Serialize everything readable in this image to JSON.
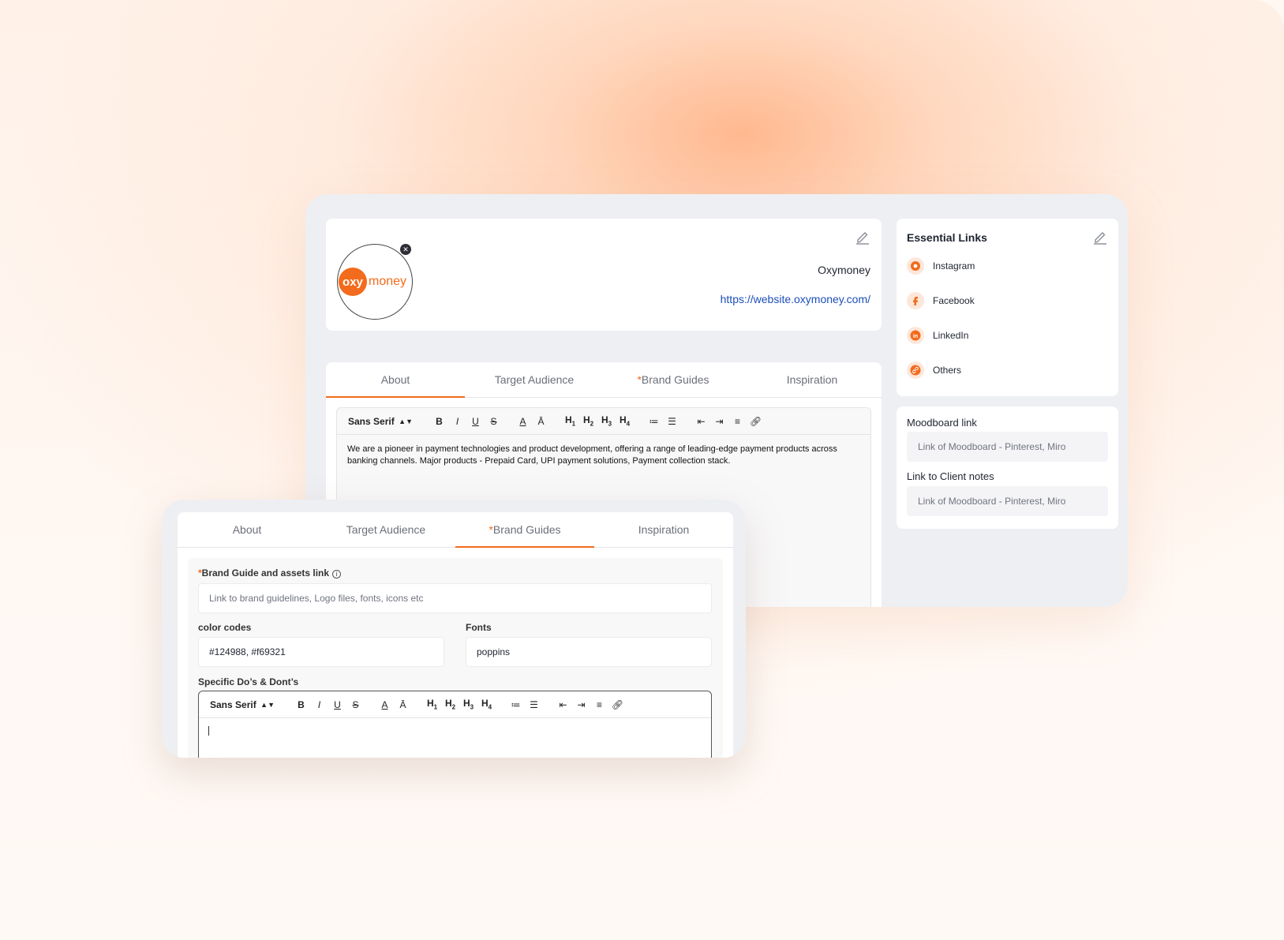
{
  "profile": {
    "logo_left": "oxy",
    "logo_right": "money",
    "brand_name": "Oxymoney",
    "website": "https://website.oxymoney.com/"
  },
  "tabs": [
    {
      "label": "About",
      "required": false
    },
    {
      "label": "Target Audience",
      "required": false
    },
    {
      "label": "Brand Guides",
      "required": true
    },
    {
      "label": "Inspiration",
      "required": false
    }
  ],
  "required_mark": "*",
  "editor": {
    "font": "Sans Serif",
    "about_text": "We are a pioneer in payment technologies and product development, offering a range of leading-edge payment products across banking channels. Major products - Prepaid Card, UPI payment solutions, Payment collection stack."
  },
  "essential_links": {
    "title": "Essential Links",
    "items": [
      {
        "label": "Instagram",
        "icon": "instagram-icon"
      },
      {
        "label": "Facebook",
        "icon": "facebook-icon"
      },
      {
        "label": "LinkedIn",
        "icon": "linkedin-icon"
      },
      {
        "label": "Others",
        "icon": "link-icon"
      }
    ]
  },
  "moodboard": {
    "label": "Moodboard link",
    "placeholder": "Link of Moodboard - Pinterest, Miro",
    "client_label": "Link to Client notes",
    "client_placeholder": "Link of Moodboard - Pinterest, Miro"
  },
  "brand_guides": {
    "assets_label": "Brand Guide and assets link",
    "assets_placeholder": "Link to brand guidelines, Logo files, fonts, icons etc",
    "color_label": "color codes",
    "color_value": "#124988, #f69321",
    "fonts_label": "Fonts",
    "fonts_value": "poppins",
    "dos_label": "Specific Do’s & Dont’s"
  },
  "colors": {
    "accent": "#f36b1c",
    "link": "#1d4fb8"
  }
}
